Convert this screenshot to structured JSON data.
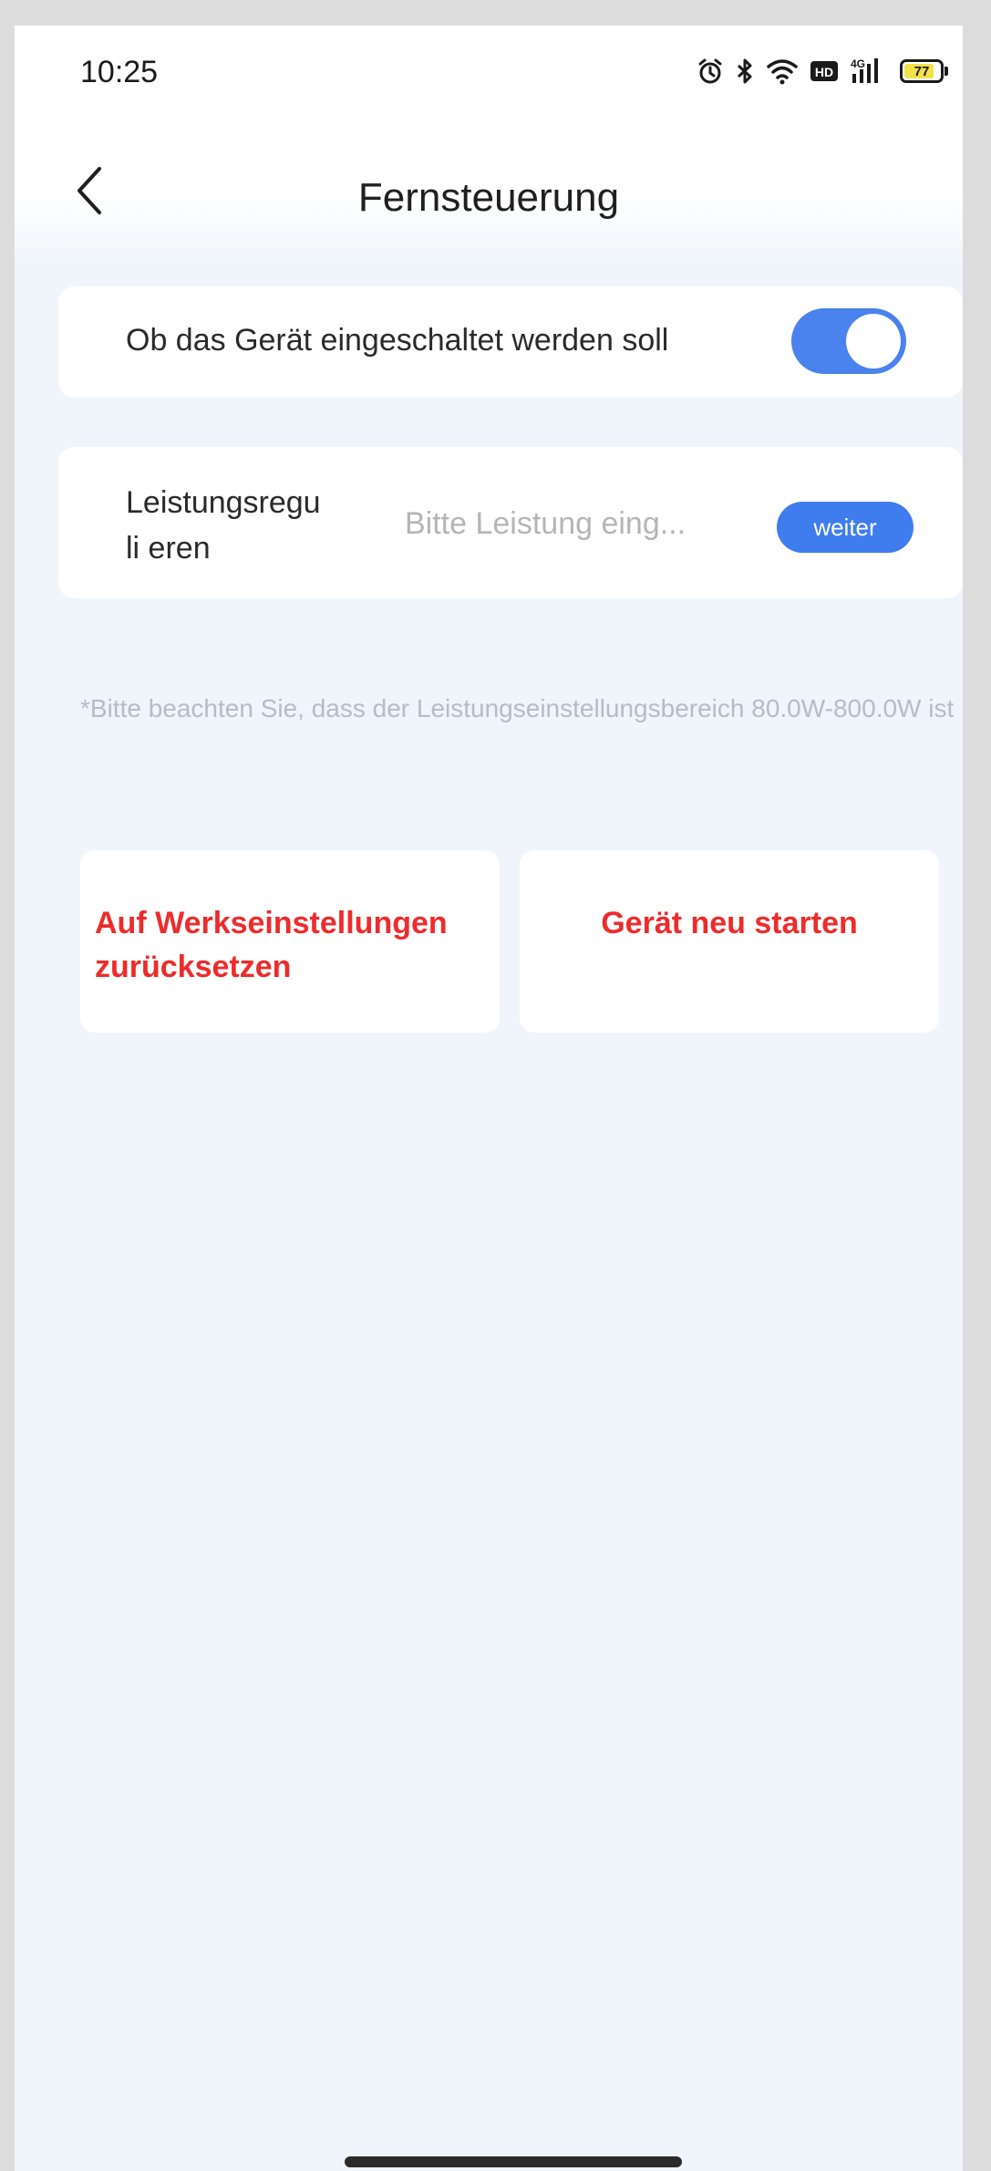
{
  "status_bar": {
    "time": "10:25",
    "network_label": "4G",
    "hd_label": "HD",
    "battery_level": "77",
    "icons": [
      "alarm-icon",
      "bluetooth-icon",
      "wifi-icon",
      "hd-icon",
      "cellular-signal-icon",
      "battery-icon"
    ]
  },
  "header": {
    "title": "Fernsteuerung",
    "back_icon": "chevron-left-icon"
  },
  "power_toggle": {
    "label": "Ob das Gerät eingeschaltet werden soll",
    "state": "on",
    "accent_color": "#4a82ee"
  },
  "power_setting": {
    "label": "Leistungsreguli eren",
    "placeholder": "Bitte Leistung eing...",
    "button_label": "weiter"
  },
  "hint": {
    "text": "*Bitte beachten Sie, dass der Leistungseinstellungsbereich 80.0W-800.0W ist"
  },
  "actions": {
    "reset_label": "Auf Werkseinstellungen zurücksetzen",
    "restart_label": "Gerät neu starten",
    "color": "#ee2b2b"
  }
}
